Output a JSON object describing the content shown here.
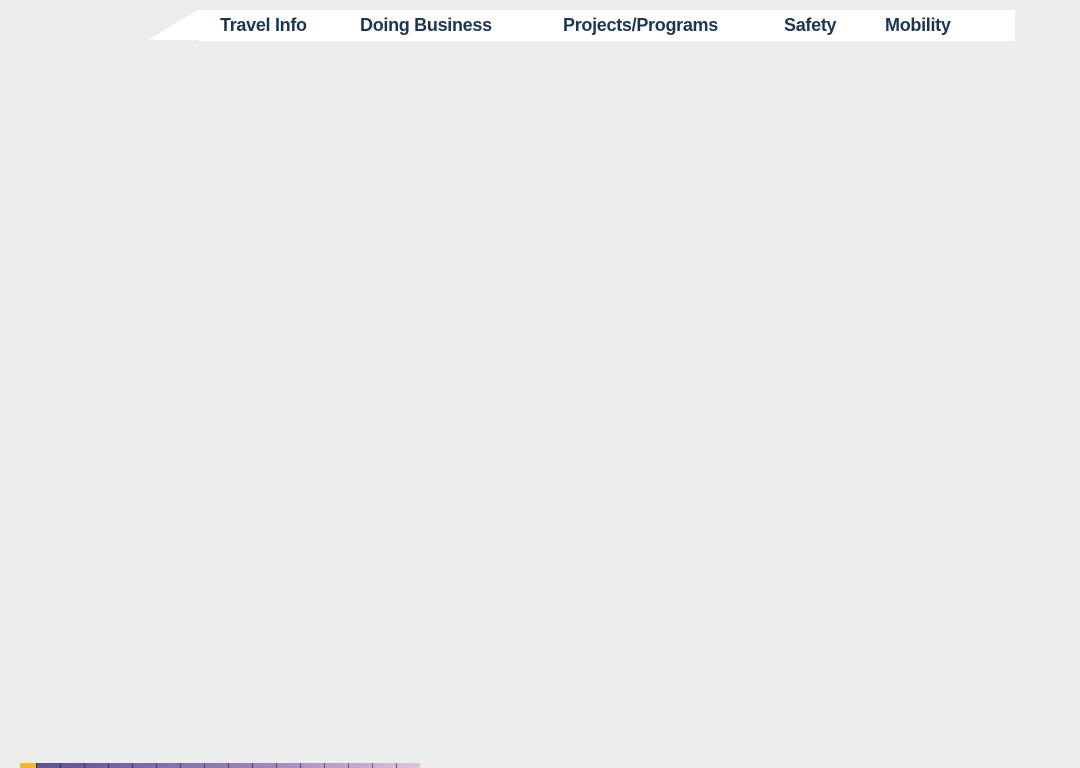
{
  "nav": {
    "items": [
      {
        "label": "Travel Info"
      },
      {
        "label": "Doing Business"
      },
      {
        "label": "Projects/Programs"
      },
      {
        "label": "Safety"
      },
      {
        "label": "Mobility"
      }
    ]
  },
  "colors": {
    "background": "#ebeeed",
    "nav_background": "#ffffff",
    "nav_text": "#1c3651",
    "accent": "#f1b82d"
  }
}
